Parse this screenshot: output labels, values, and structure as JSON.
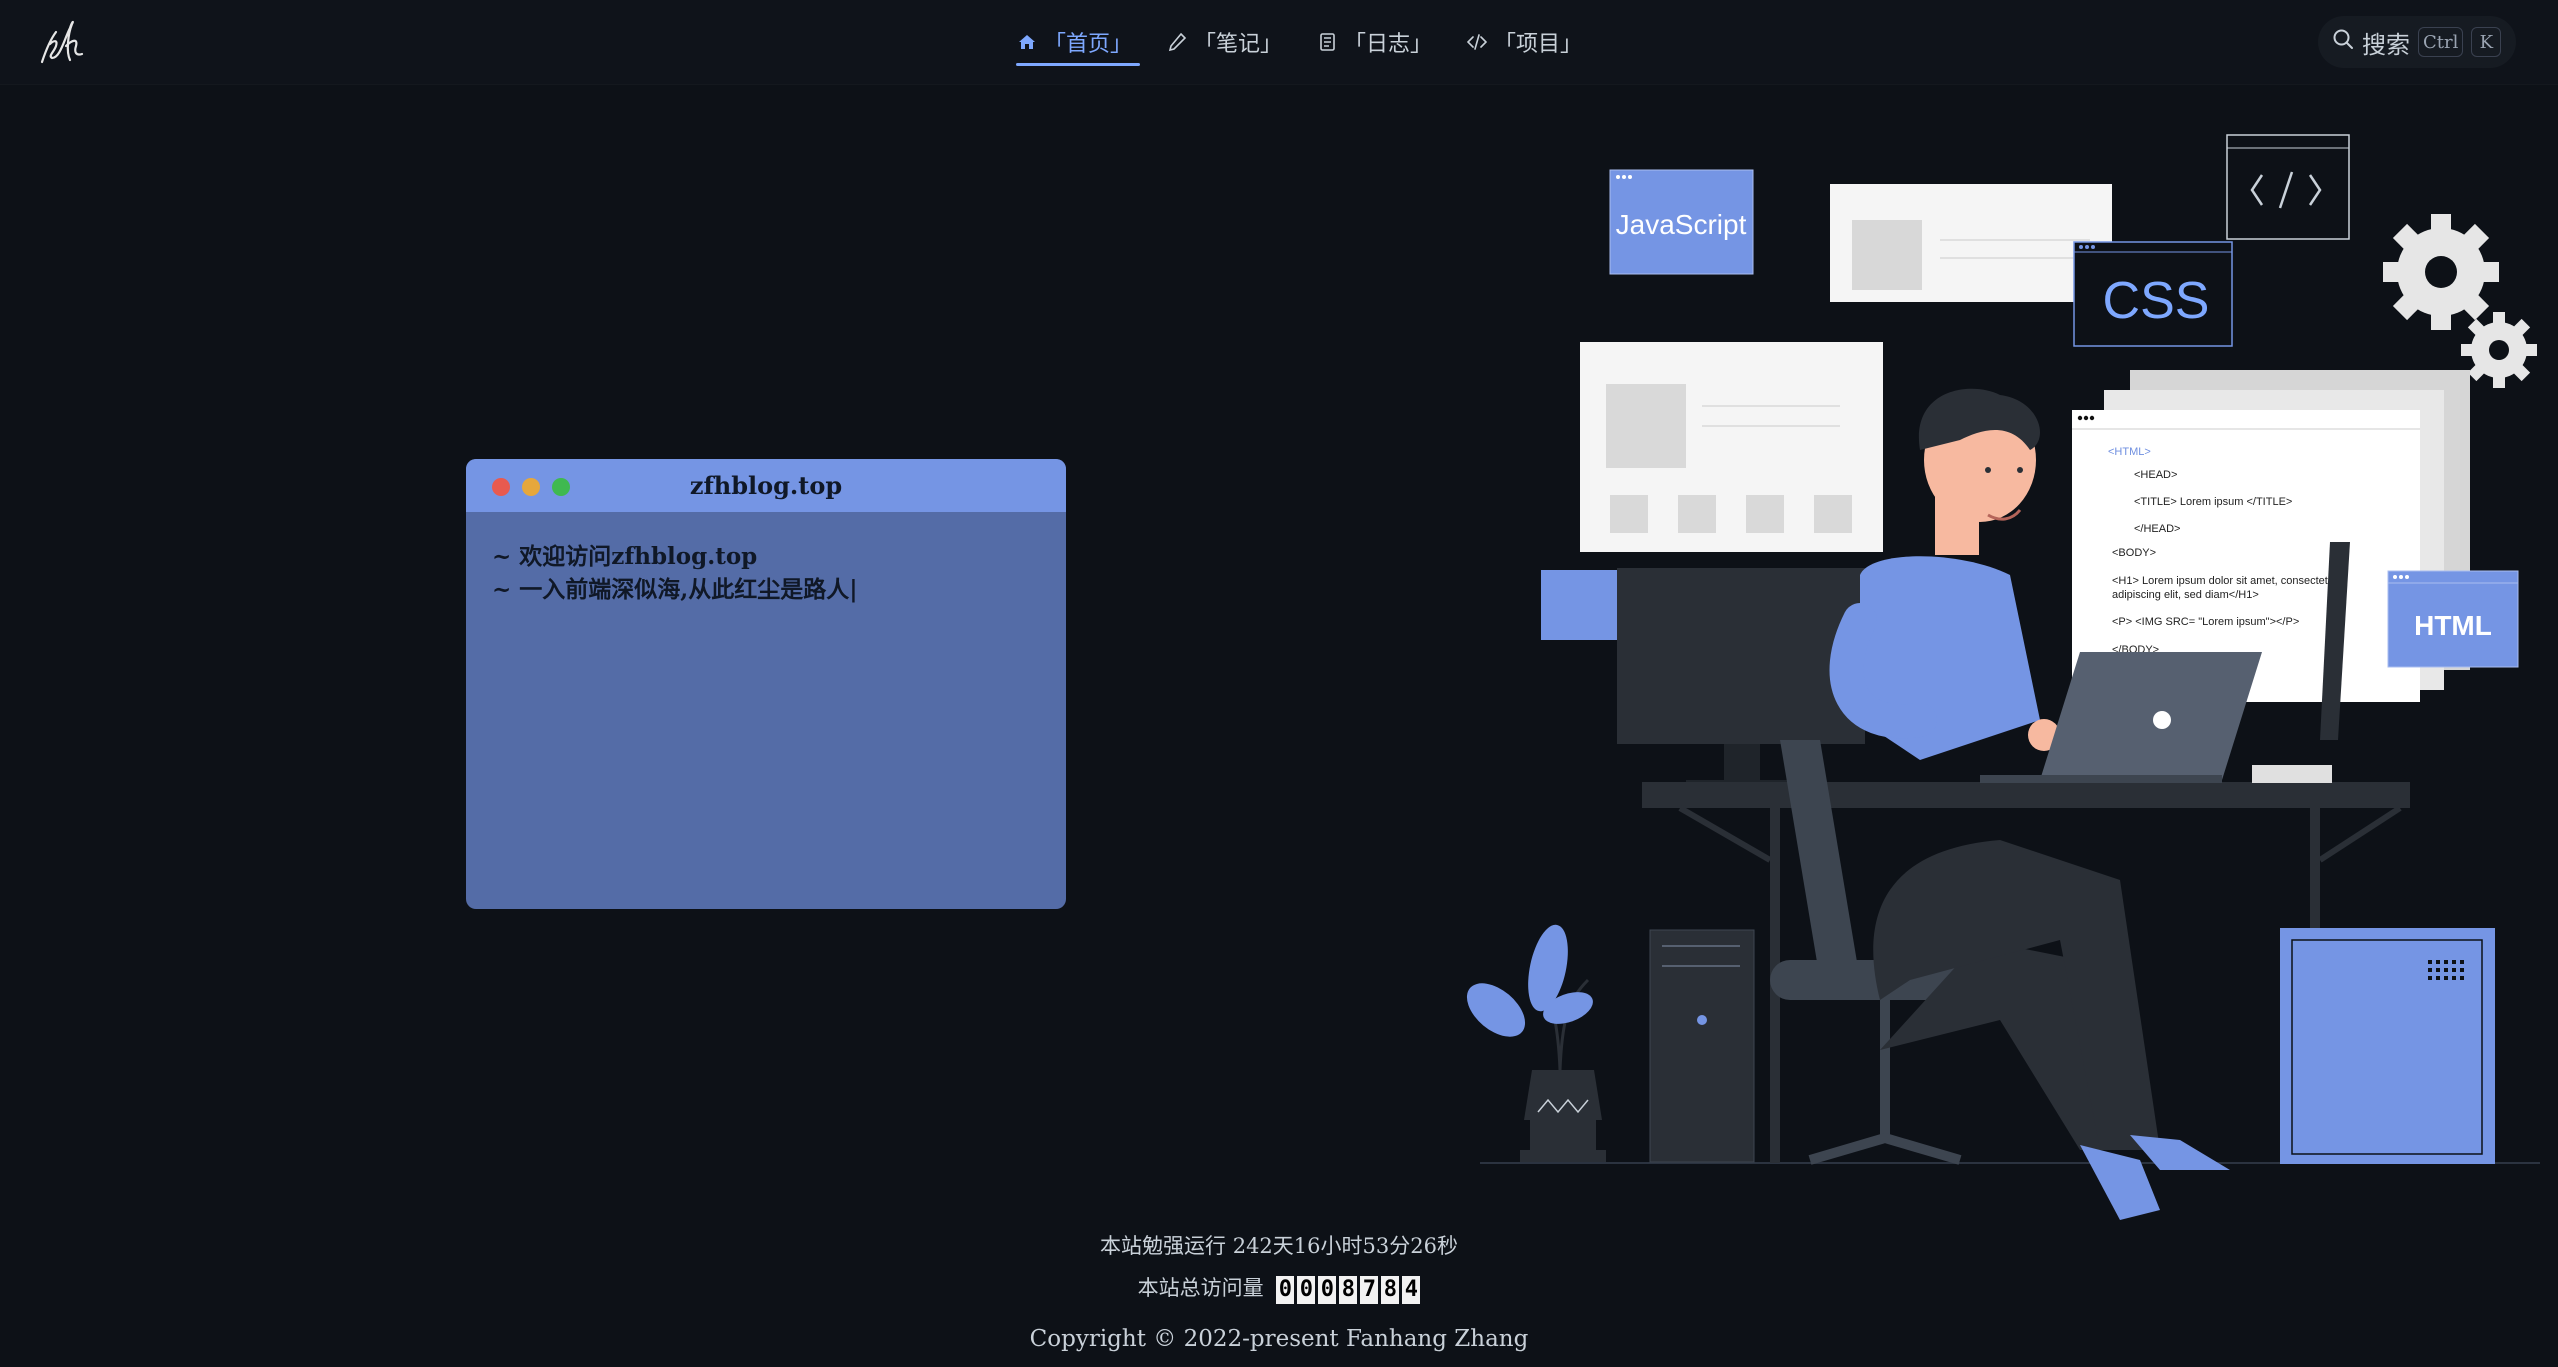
{
  "header": {
    "logo_text": "zfh",
    "nav": [
      {
        "icon": "home-icon",
        "label": "「首页」",
        "active": true
      },
      {
        "icon": "pen-icon",
        "label": "「笔记」",
        "active": false
      },
      {
        "icon": "notebook-icon",
        "label": "「日志」",
        "active": false
      },
      {
        "icon": "code-icon",
        "label": "「项目」",
        "active": false
      }
    ],
    "search": {
      "label": "搜索",
      "key1": "Ctrl",
      "key2": "K"
    }
  },
  "terminal": {
    "title": "zfhblog.top",
    "lines": [
      "~ 欢迎访问zfhblog.top",
      "~ 一入前端深似海,从此红尘是路人|"
    ]
  },
  "illustration": {
    "badge_js": "JavaScript",
    "badge_css": "CSS",
    "badge_html": "HTML",
    "code_lines": [
      "<HTML>",
      "<HEAD>",
      "<TITLE> Lorem ipsum </TITLE>",
      "</HEAD>",
      "<BODY>",
      "<H1> Lorem ipsum dolor sit amet, consectetuer",
      "adipiscing elit, sed diam</H1>",
      "<P> <IMG SRC= \"Lorem ipsum\"></P>",
      "</BODY>"
    ]
  },
  "footer": {
    "runtime": "本站勉强运行 242天16小时53分26秒",
    "visits_label": "本站总访问量",
    "visits_digits": [
      "0",
      "0",
      "0",
      "8",
      "7",
      "8",
      "4"
    ],
    "copyright": "Copyright © 2022-present Fanhang Zhang"
  },
  "colors": {
    "background": "#0d1117",
    "accent": "#7ea8ff",
    "terminal_bar": "#7595e4",
    "terminal_body": "#546ca7"
  }
}
